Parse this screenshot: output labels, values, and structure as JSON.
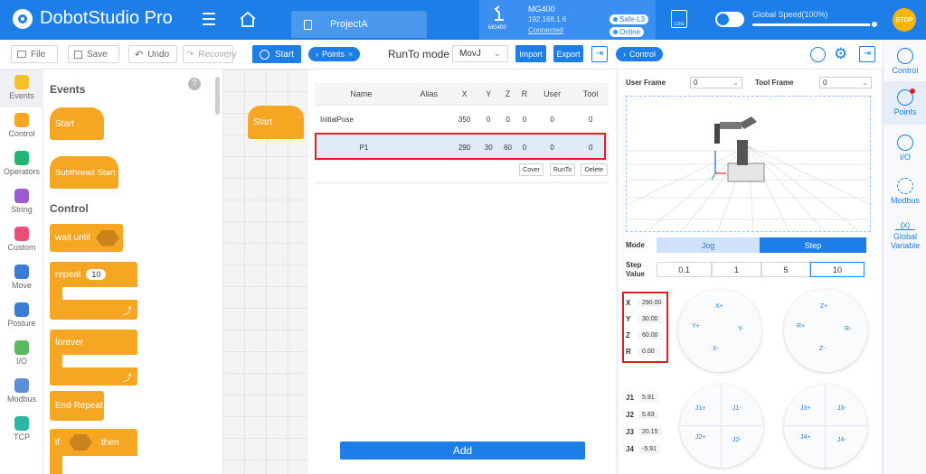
{
  "app": {
    "title": "DobotStudio Pro",
    "project_tab": "ProjectA"
  },
  "device": {
    "model": "MG400",
    "ip": "192.168.1.6",
    "status": "Connected",
    "safety": "Safe-L3",
    "online": "Online",
    "log": "LOG",
    "icon_label": "MG400"
  },
  "speed": {
    "label": "Global Speed(100%)",
    "value_percent": 100
  },
  "stop_label": "STOP",
  "toolbar": {
    "file": "File",
    "save": "Save",
    "undo": "Undo",
    "recovery": "Recovery",
    "start": "Start",
    "points_tab": "Points",
    "runto_label": "RunTo mode",
    "runto_value": "MovJ",
    "import": "Import",
    "export": "Export",
    "control_tab": "Control"
  },
  "categories": [
    {
      "label": "Events",
      "color": "#f6c027",
      "icon": "events-icon"
    },
    {
      "label": "Control",
      "color": "#f6a623",
      "icon": "control-icon"
    },
    {
      "label": "Operators",
      "color": "#22b573",
      "icon": "operators-icon"
    },
    {
      "label": "String",
      "color": "#9d5bd2",
      "icon": "string-icon"
    },
    {
      "label": "Custom",
      "color": "#e8507a",
      "icon": "custom-icon"
    },
    {
      "label": "Move",
      "color": "#3a7bd5",
      "icon": "move-icon"
    },
    {
      "label": "Posture",
      "color": "#3a7bd5",
      "icon": "posture-icon"
    },
    {
      "label": "I/O",
      "color": "#5cb85c",
      "icon": "io-icon"
    },
    {
      "label": "Modbus",
      "color": "#5b8fd8",
      "icon": "modbus-icon"
    },
    {
      "label": "TCP",
      "color": "#2ab6a0",
      "icon": "tcp-icon"
    }
  ],
  "palette": {
    "events_title": "Events",
    "start_block": "Start",
    "subthread_block": "Subthread Start",
    "control_title": "Control",
    "wait_until": "wait until",
    "repeat": "repeat",
    "repeat_count": "10",
    "forever": "forever",
    "end_repeat": "End Repeat",
    "if": "if",
    "then": "then"
  },
  "workspace": {
    "start_block": "Start"
  },
  "points_table": {
    "headers": [
      "Name",
      "Alias",
      "X",
      "Y",
      "Z",
      "R",
      "User",
      "Tool"
    ],
    "rows": [
      [
        "InitialPose",
        "",
        "350",
        "0",
        "0",
        "0",
        "0",
        "0"
      ],
      [
        "P1",
        "",
        "290",
        "30",
        "60",
        "0",
        "0",
        "0"
      ]
    ],
    "actions": [
      "Cover",
      "RunTo",
      "Delete"
    ],
    "add_button": "Add"
  },
  "control_panel": {
    "user_frame_label": "User Frame",
    "user_frame_value": "0",
    "tool_frame_label": "Tool Frame",
    "tool_frame_value": "0",
    "mode_label": "Mode",
    "mode_options": [
      "Jog",
      "Step"
    ],
    "step_label": "Step\nValue",
    "step_values": [
      "0.1",
      "1",
      "5",
      "10"
    ],
    "coords": [
      {
        "axis": "X",
        "value": "290.00"
      },
      {
        "axis": "Y",
        "value": "30.00"
      },
      {
        "axis": "Z",
        "value": "60.00"
      },
      {
        "axis": "R",
        "value": "0.00"
      }
    ],
    "joints": [
      {
        "axis": "J1",
        "value": "5.91"
      },
      {
        "axis": "J2",
        "value": "5.83"
      },
      {
        "axis": "J3",
        "value": "20.15"
      },
      {
        "axis": "J4",
        "value": "-5.91"
      }
    ],
    "xy_wheel": {
      "top": "X+",
      "left": "Y+",
      "right": "Y-",
      "bottom": "X-"
    },
    "zr_wheel": {
      "top": "Z+",
      "left": "R+",
      "right": "R-",
      "bottom": "Z-"
    },
    "j12_wheel": {
      "tl": "J1+",
      "tr": "J1-",
      "bl": "J2+",
      "br": "J2-"
    },
    "j34_wheel": {
      "tl": "J3+",
      "tr": "J3-",
      "bl": "J4+",
      "br": "J4-"
    }
  },
  "right_nav": [
    {
      "label": "Control",
      "icon": "control-icon"
    },
    {
      "label": "Points",
      "icon": "points-icon"
    },
    {
      "label": "I/O",
      "icon": "io-icon"
    },
    {
      "label": "Modbus",
      "icon": "modbus-icon"
    },
    {
      "label": "Global Variable",
      "icon": "variable-icon",
      "glyph": "(x)"
    }
  ]
}
